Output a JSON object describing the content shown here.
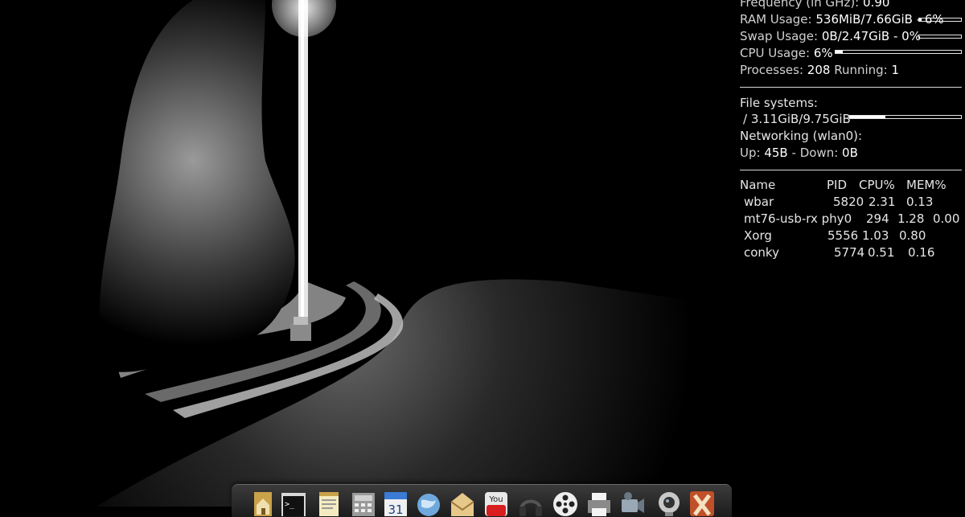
{
  "conky": {
    "frequency": {
      "label": "Frequency (in GHz):",
      "value": "0.90"
    },
    "ram": {
      "label": "RAM Usage:",
      "value": "536MiB/7.66GiB - 6%",
      "fraction": 0.06
    },
    "swap": {
      "label": "Swap Usage:",
      "value": "0B/2.47GiB - 0%",
      "fraction": 0.0
    },
    "cpu": {
      "label": "CPU Usage:",
      "value": "6%",
      "fraction": 0.06
    },
    "processes": {
      "label": "Processes:",
      "count": "208",
      "running_label": "Running:",
      "running": "1"
    },
    "filesystems": {
      "label": "File systems:",
      "root": "/ 3.11GiB/9.75GiB",
      "fraction": 0.32
    },
    "networking": {
      "label": "Networking (wlan0):",
      "up_label": "Up:",
      "up": "45B",
      "down_label": "- Down:",
      "down": "0B"
    },
    "process_table": {
      "headers": [
        "Name",
        "PID",
        "CPU%",
        "MEM%"
      ],
      "rows": [
        {
          "name": "wbar",
          "pid": "5820",
          "cpu": "2.31",
          "mem": "0.13"
        },
        {
          "name": "mt76-usb-rx phy0",
          "pid": "294",
          "cpu": "1.28",
          "mem": "0.00"
        },
        {
          "name": "Xorg",
          "pid": "5556",
          "cpu": "1.03",
          "mem": "0.80"
        },
        {
          "name": "conky",
          "pid": "5774",
          "cpu": "0.51",
          "mem": "0.16"
        }
      ]
    }
  },
  "dock": {
    "icons": [
      "home-folder-icon",
      "terminal-icon",
      "text-editor-icon",
      "calculator-icon",
      "calendar-icon",
      "web-browser-icon",
      "mail-icon",
      "youtube-icon",
      "headphones-icon",
      "film-reel-icon",
      "printer-icon",
      "video-camera-icon",
      "webcam-icon",
      "close-x-icon"
    ],
    "calendar_day": "31",
    "youtube_text": "You"
  }
}
